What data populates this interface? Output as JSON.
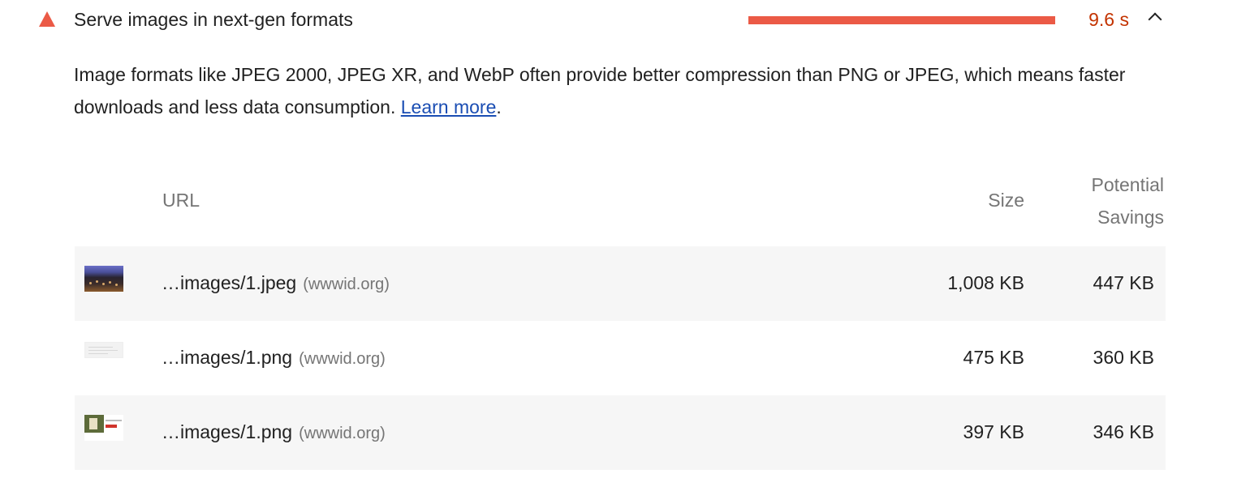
{
  "audit": {
    "title": "Serve images in next-gen formats",
    "status_icon": "fail-triangle-icon",
    "metric_value": "9.6 s",
    "metric_color": "#eb5a46",
    "toggle_icon": "chevron-up-icon",
    "description": "Image formats like JPEG 2000, JPEG XR, and WebP often provide better compression than PNG or JPEG, which means faster downloads and less data consumption.",
    "learn_more": "Learn more",
    "trailing_period": "."
  },
  "table": {
    "headers": {
      "url": "URL",
      "size": "Size",
      "savings_line1": "Potential",
      "savings_line2": "Savings"
    },
    "rows": [
      {
        "url": "…images/1.jpeg",
        "host": "(wwwid.org)",
        "size": "1,008 KB",
        "savings": "447 KB"
      },
      {
        "url": "…images/1.png",
        "host": "(wwwid.org)",
        "size": "475 KB",
        "savings": "360 KB"
      },
      {
        "url": "…images/1.png",
        "host": "(wwwid.org)",
        "size": "397 KB",
        "savings": "346 KB"
      }
    ]
  }
}
